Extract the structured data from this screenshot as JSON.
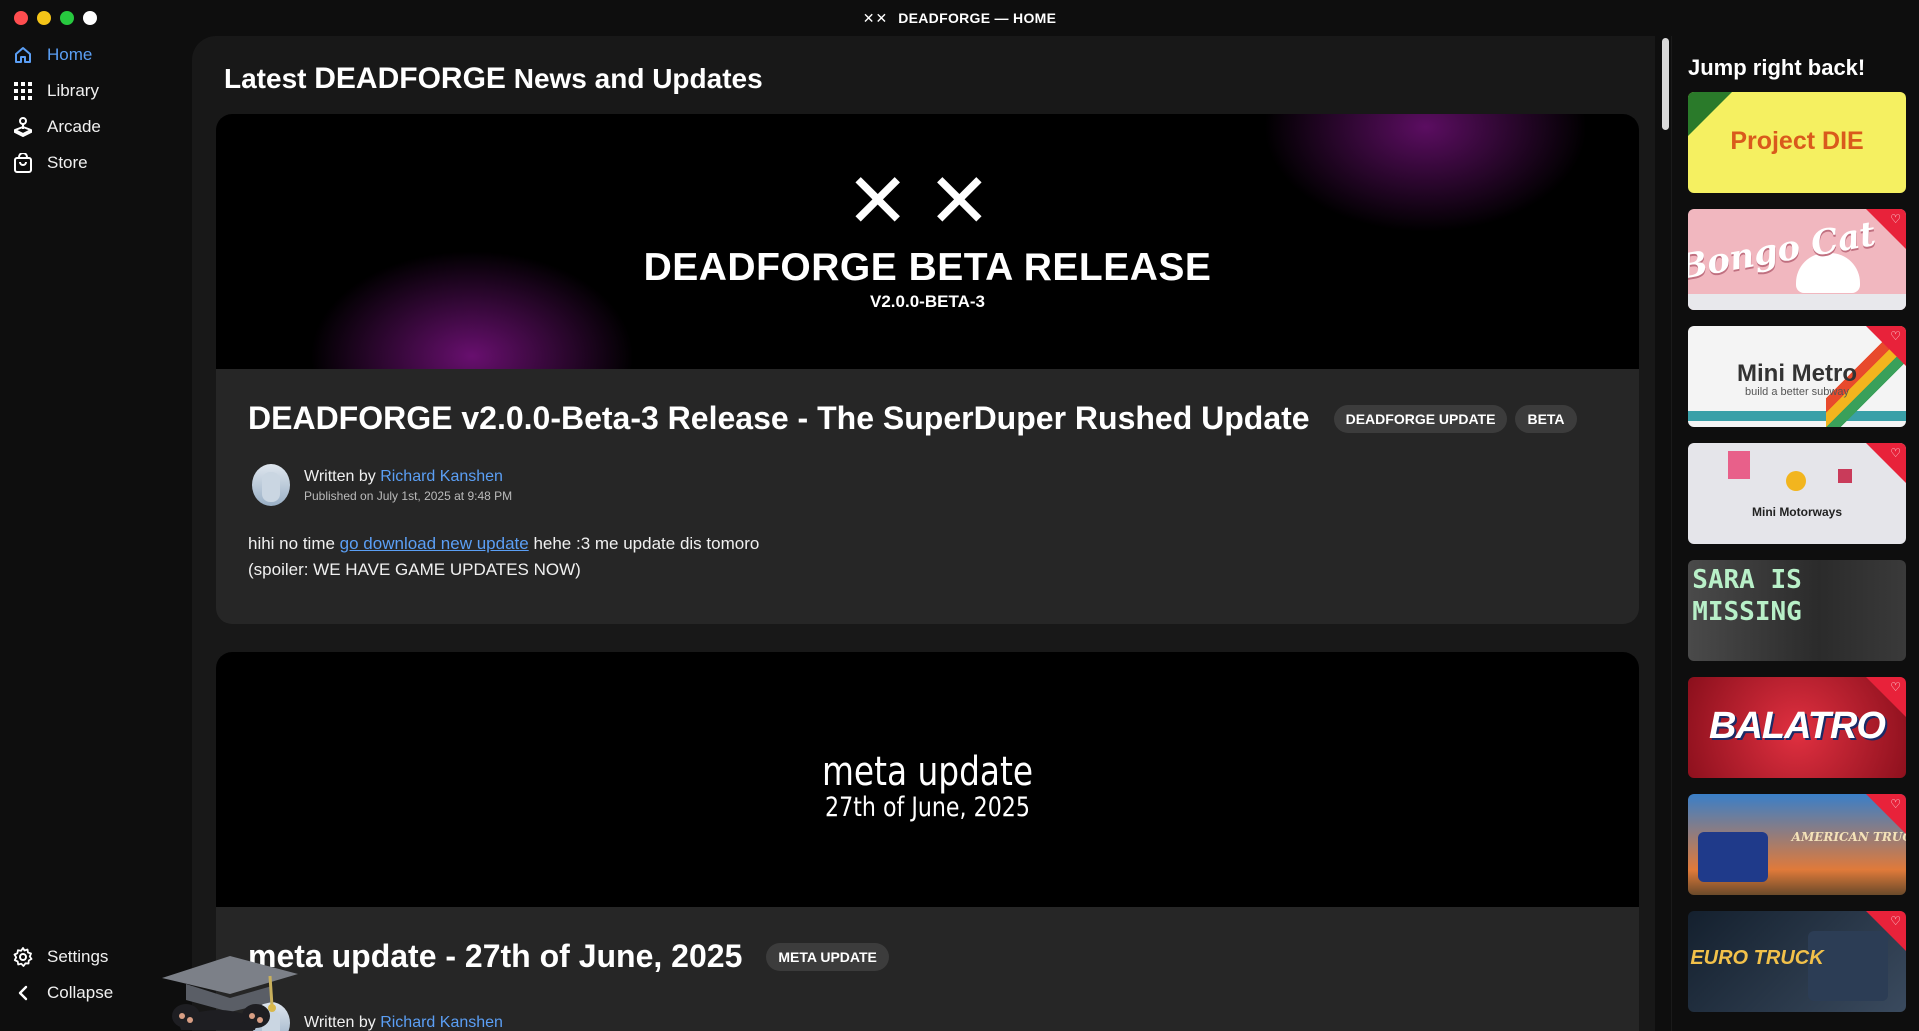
{
  "window": {
    "title": "DEADFORGE — HOME",
    "title_logo": "✕✕",
    "traffic_colors": [
      "#ff4d4f",
      "#f5c518",
      "#27c93f",
      "#ffffff"
    ]
  },
  "sidebar": {
    "items": [
      {
        "label": "Home",
        "icon": "home-icon",
        "active": true
      },
      {
        "label": "Library",
        "icon": "grid-icon"
      },
      {
        "label": "Arcade",
        "icon": "joystick-icon"
      },
      {
        "label": "Store",
        "icon": "shopping-bag-icon"
      }
    ],
    "settings_label": "Settings",
    "collapse_label": "Collapse"
  },
  "main": {
    "heading_prefix": "Latest ",
    "heading_brand": "DEADFORGE",
    "heading_suffix": " News and Updates",
    "posts": [
      {
        "banner_logo": "✕✕",
        "banner_title": "DEADFORGE BETA RELEASE",
        "banner_subtitle": "V2.0.0-BETA-3",
        "title": "DEADFORGE v2.0.0-Beta-3 Release - The SuperDuper Rushed Update",
        "tags": [
          "DEADFORGE UPDATE",
          "BETA"
        ],
        "written_by": "Written by",
        "author": "Richard Kanshen",
        "published": "Published on July 1st, 2025 at 9:48 PM",
        "body_before_link": "hihi no time ",
        "body_link": "go download new update",
        "body_after_link": " hehe :3 me update dis tomoro",
        "body_line2": "(spoiler: WE HAVE GAME UPDATES NOW)"
      },
      {
        "banner_title": "meta update",
        "banner_subtitle": "27th of June, 2025",
        "title": "meta update - 27th of June, 2025",
        "tags": [
          "META UPDATE"
        ],
        "written_by": "Written by",
        "author": "Richard Kanshen"
      }
    ]
  },
  "rail": {
    "title": "Jump right back!",
    "games": [
      {
        "name": "Project DIE",
        "bg": "#f5f061",
        "fg": "#d95a1c",
        "favorite": false
      },
      {
        "name": "Bongo Cat",
        "bg": "#f1b7bf",
        "fg": "#ffffff",
        "favorite": true
      },
      {
        "name": "Mini Metro",
        "tagline": "build a better subway",
        "bg": "#f4f4f4",
        "fg": "#333333",
        "favorite": true
      },
      {
        "name": "Mini Motorways",
        "bg": "#e5e5ea",
        "fg": "#222222",
        "favorite": true
      },
      {
        "name": "SARA IS MISSING",
        "bg": "#3a3a3a",
        "fg": "#b8f0c8",
        "favorite": false
      },
      {
        "name": "BALATRO",
        "bg": "#c21f2c",
        "fg": "#ffffff",
        "favorite": true
      },
      {
        "name": "AMERICAN TRUCK",
        "bg": "#2f6fb7",
        "fg": "#f4e2b8",
        "favorite": true
      },
      {
        "name": "EURO TRUCK",
        "bg": "#1b2a3c",
        "fg": "#f2c14a",
        "favorite": true
      }
    ]
  },
  "colors": {
    "accent": "#5b9ff5",
    "card": "#262626",
    "panel": "#181818",
    "favorite": "#e8223a"
  }
}
